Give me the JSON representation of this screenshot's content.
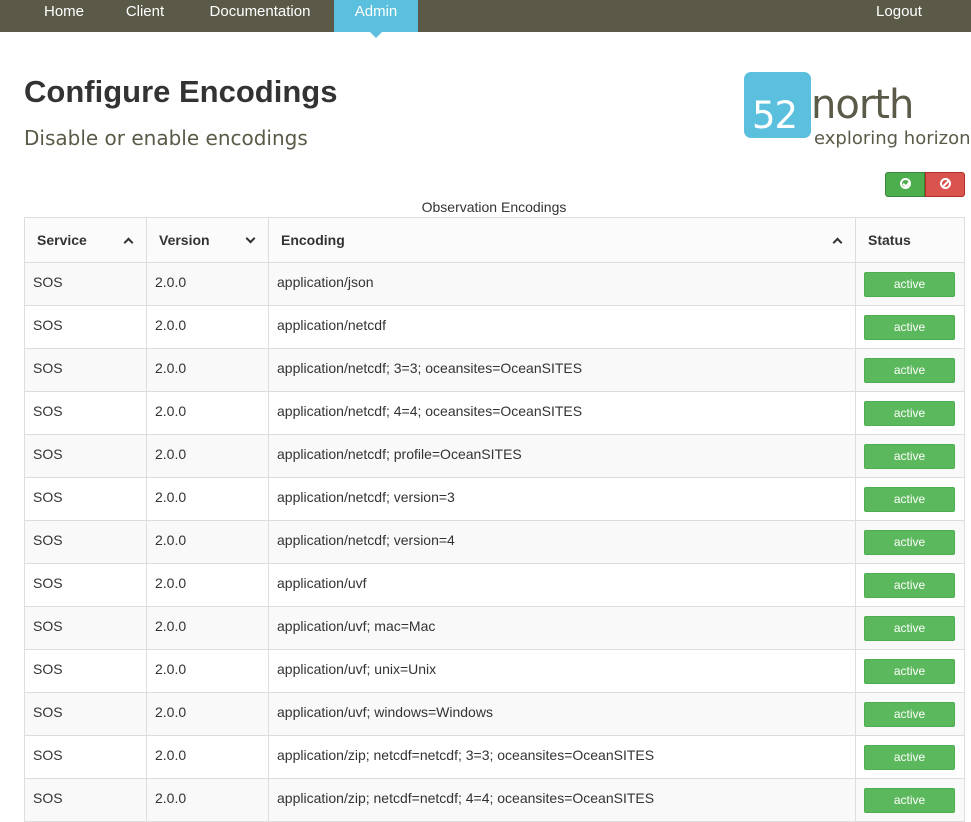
{
  "nav": {
    "items": [
      {
        "label": "Home"
      },
      {
        "label": "Client"
      },
      {
        "label": "Documentation"
      },
      {
        "label": "Admin"
      }
    ],
    "logout": "Logout",
    "active_color": "#5bc0de",
    "bar_color": "#5b5a48"
  },
  "header": {
    "title": "Configure Encodings",
    "subtitle": "Disable or enable encodings"
  },
  "logo": {
    "mark": "52",
    "word": "north",
    "tagline": "exploring horizons"
  },
  "actions": {
    "enable_all_icon": "ok-circle-icon",
    "disable_all_icon": "ban-circle-icon"
  },
  "table": {
    "caption": "Observation Encodings",
    "columns": [
      "Service",
      "Version",
      "Encoding",
      "Status"
    ],
    "rows": [
      [
        "SOS",
        "2.0.0",
        "application/json",
        "active"
      ],
      [
        "SOS",
        "2.0.0",
        "application/netcdf",
        "active"
      ],
      [
        "SOS",
        "2.0.0",
        "application/netcdf; 3=3; oceansites=OceanSITES",
        "active"
      ],
      [
        "SOS",
        "2.0.0",
        "application/netcdf; 4=4; oceansites=OceanSITES",
        "active"
      ],
      [
        "SOS",
        "2.0.0",
        "application/netcdf; profile=OceanSITES",
        "active"
      ],
      [
        "SOS",
        "2.0.0",
        "application/netcdf; version=3",
        "active"
      ],
      [
        "SOS",
        "2.0.0",
        "application/netcdf; version=4",
        "active"
      ],
      [
        "SOS",
        "2.0.0",
        "application/uvf",
        "active"
      ],
      [
        "SOS",
        "2.0.0",
        "application/uvf; mac=Mac",
        "active"
      ],
      [
        "SOS",
        "2.0.0",
        "application/uvf; unix=Unix",
        "active"
      ],
      [
        "SOS",
        "2.0.0",
        "application/uvf; windows=Windows",
        "active"
      ],
      [
        "SOS",
        "2.0.0",
        "application/zip; netcdf=netcdf; 3=3; oceansites=OceanSITES",
        "active"
      ],
      [
        "SOS",
        "2.0.0",
        "application/zip; netcdf=netcdf; 4=4; oceansites=OceanSITES",
        "active"
      ]
    ]
  }
}
